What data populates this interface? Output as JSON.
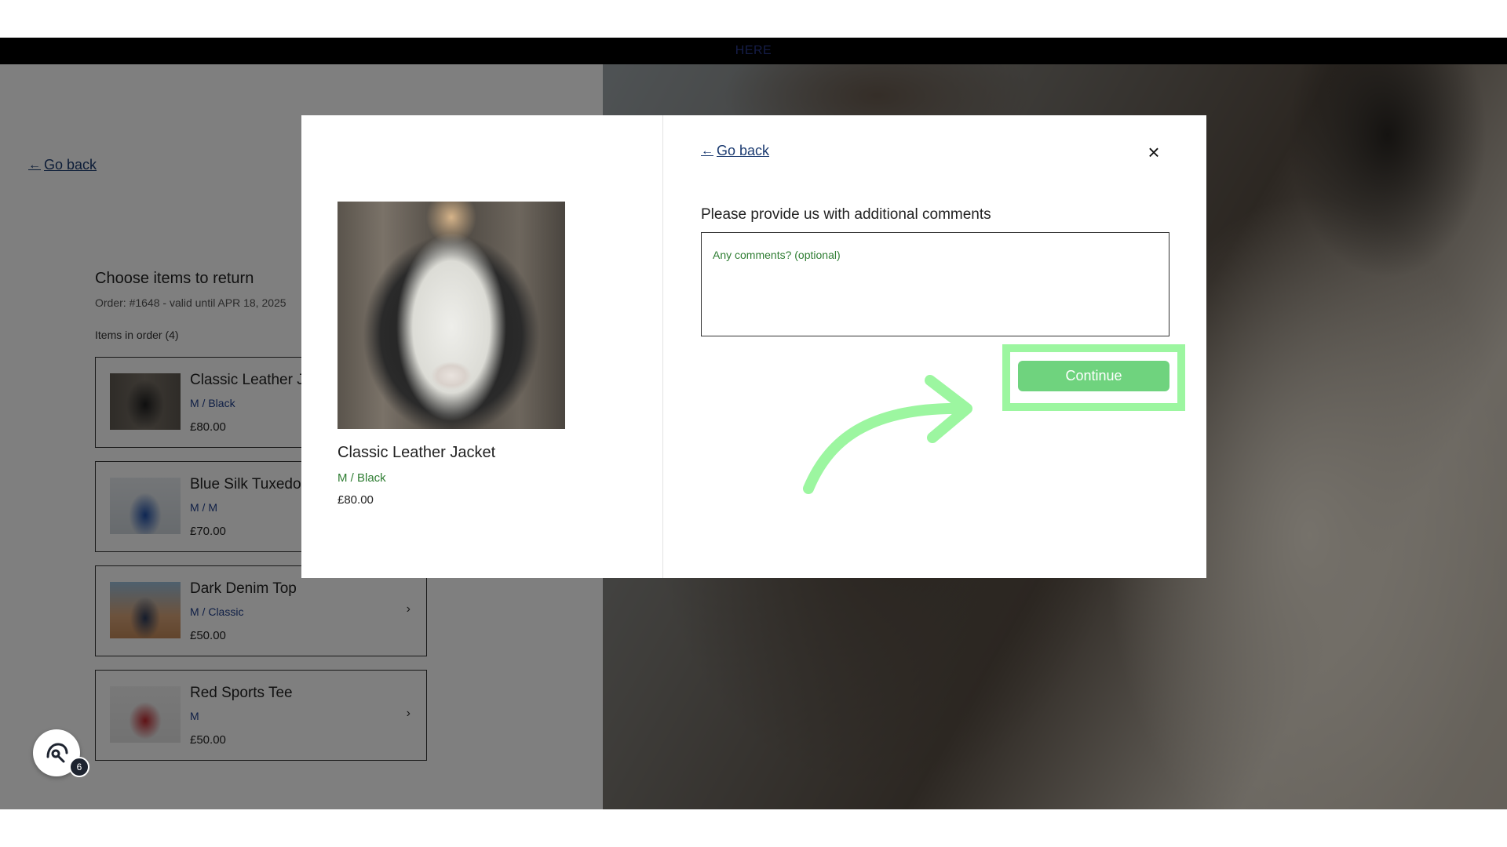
{
  "announcement": {
    "text": "HERE"
  },
  "page": {
    "go_back_label": "Go back",
    "title": "Choose items to return",
    "order_line": "Order: #1648 - valid until APR 18, 2025",
    "items_label": "Items in order (4)",
    "items": [
      {
        "name": "Classic Leather Jacket",
        "variant": "M / Black",
        "price": "£80.00",
        "thumb": "leather-jacket-thumb"
      },
      {
        "name": "Blue Silk Tuxedo",
        "variant": "M / M",
        "price": "£70.00",
        "thumb": "tuxedo-thumb"
      },
      {
        "name": "Dark Denim Top",
        "variant": "M / Classic",
        "price": "£50.00",
        "thumb": "denim-top-thumb"
      },
      {
        "name": "Red Sports Tee",
        "variant": "M",
        "price": "£50.00",
        "thumb": "sports-tee-thumb"
      }
    ]
  },
  "modal": {
    "go_back_label": "Go back",
    "close_icon": "close-icon",
    "product": {
      "name": "Classic Leather Jacket",
      "variant": "M / Black",
      "price": "£80.00"
    },
    "comments_title": "Please provide us with additional comments",
    "comments_placeholder": "Any comments? (optional)",
    "comments_value": "",
    "continue_label": "Continue"
  },
  "guide": {
    "highlight_color": "#9cf6a0",
    "arrow_color": "#9cf6a0"
  },
  "help_widget": {
    "badge_count": "6"
  },
  "colors": {
    "accent_green": "#6fd37e",
    "link_blue": "#1a3a70",
    "variant_blue": "#1f3e8c"
  }
}
